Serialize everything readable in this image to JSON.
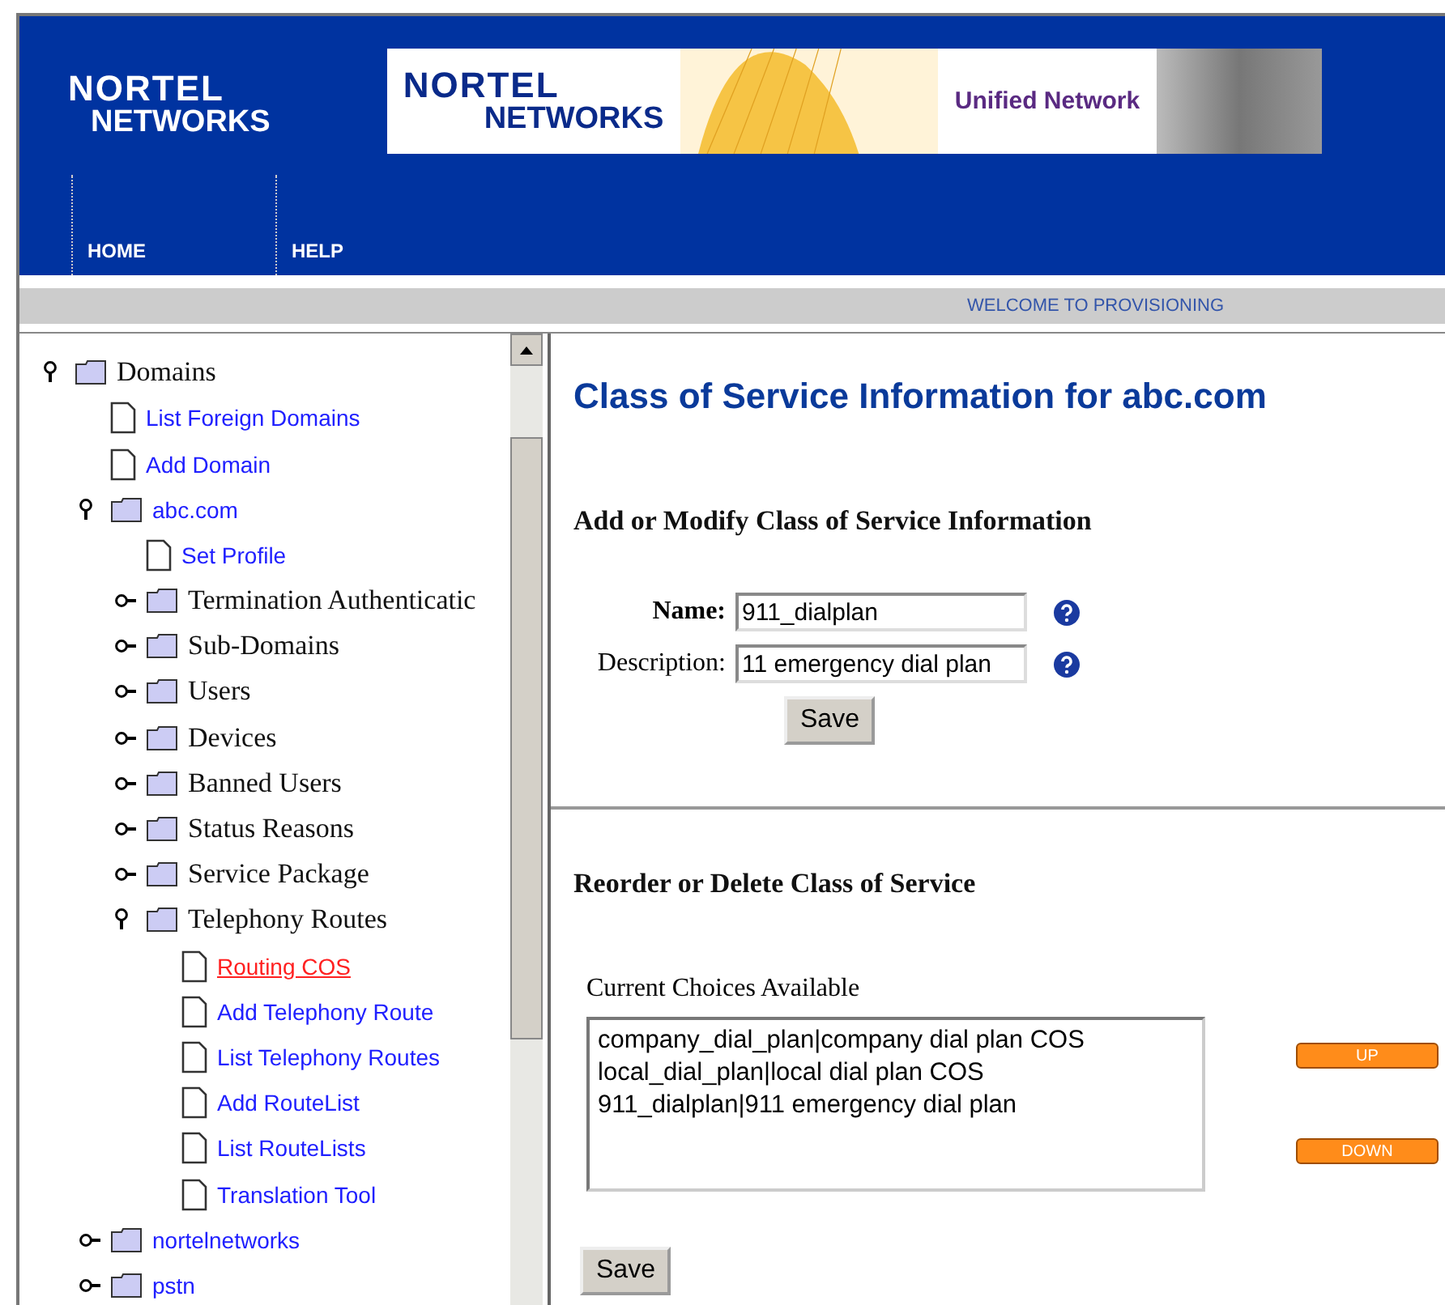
{
  "header": {
    "logo": [
      "NORTEL",
      "NETWORKS"
    ],
    "banner": {
      "logo": [
        "NORTEL",
        "NETWORKS"
      ],
      "tagline": "Unified Network"
    },
    "nav": [
      "HOME",
      "HELP"
    ]
  },
  "welcome": "WELCOME TO PROVISIONING",
  "tree": [
    {
      "kind": "folder",
      "label": "Domains",
      "link": false,
      "expanded": true,
      "selected": false,
      "children": [
        {
          "kind": "page",
          "label": "List Foreign Domains",
          "link": true,
          "selected": false
        },
        {
          "kind": "page",
          "label": "Add Domain",
          "link": true,
          "selected": false
        },
        {
          "kind": "folder",
          "label": "abc.com",
          "link": true,
          "expanded": true,
          "selected": false,
          "children": [
            {
              "kind": "page",
              "label": "Set Profile",
              "link": true,
              "selected": false
            },
            {
              "kind": "folder",
              "label": "Termination Authenticatic",
              "link": false,
              "expanded": false,
              "selected": false
            },
            {
              "kind": "folder",
              "label": "Sub-Domains",
              "link": false,
              "expanded": false,
              "selected": false
            },
            {
              "kind": "folder",
              "label": "Users",
              "link": false,
              "expanded": false,
              "selected": false
            },
            {
              "kind": "folder",
              "label": "Devices",
              "link": false,
              "expanded": false,
              "selected": false
            },
            {
              "kind": "folder",
              "label": "Banned Users",
              "link": false,
              "expanded": false,
              "selected": false
            },
            {
              "kind": "folder",
              "label": "Status Reasons",
              "link": false,
              "expanded": false,
              "selected": false
            },
            {
              "kind": "folder",
              "label": "Service Package",
              "link": false,
              "expanded": false,
              "selected": false
            },
            {
              "kind": "folder",
              "label": "Telephony Routes",
              "link": false,
              "expanded": true,
              "selected": false,
              "children": [
                {
                  "kind": "page",
                  "label": "Routing COS",
                  "link": true,
                  "selected": true
                },
                {
                  "kind": "page",
                  "label": "Add Telephony Route",
                  "link": true,
                  "selected": false
                },
                {
                  "kind": "page",
                  "label": "List Telephony Routes",
                  "link": true,
                  "selected": false
                },
                {
                  "kind": "page",
                  "label": "Add RouteList",
                  "link": true,
                  "selected": false
                },
                {
                  "kind": "page",
                  "label": "List RouteLists",
                  "link": true,
                  "selected": false
                },
                {
                  "kind": "page",
                  "label": "Translation Tool",
                  "link": true,
                  "selected": false
                }
              ]
            }
          ]
        },
        {
          "kind": "folder",
          "label": "nortelnetworks",
          "link": true,
          "expanded": false,
          "selected": false
        },
        {
          "kind": "folder",
          "label": "pstn",
          "link": true,
          "expanded": false,
          "selected": false
        }
      ]
    }
  ],
  "content": {
    "title": "Class of Service Information for abc.com",
    "form": {
      "heading": "Add or Modify Class of Service Information",
      "fields": [
        {
          "label": "Name:",
          "value": "911_dialplan",
          "bold": true
        },
        {
          "label": "Description:",
          "value": "11 emergency dial plan",
          "bold": false
        }
      ],
      "save": "Save"
    },
    "reorder": {
      "heading": "Reorder or Delete Class of Service",
      "list_label": "Current Choices Available",
      "choices": [
        "company_dial_plan|company dial plan COS",
        "local_dial_plan|local dial plan COS",
        "911_dialplan|911 emergency dial plan"
      ],
      "up": "UP",
      "down": "DOWN",
      "save": "Save"
    }
  }
}
